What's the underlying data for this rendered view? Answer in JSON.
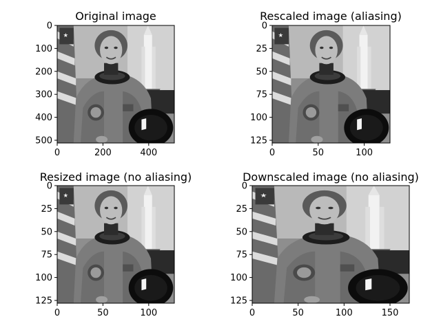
{
  "figure": {
    "background": "#ffffff"
  },
  "chart_data": [
    {
      "type": "image",
      "title": "Original image",
      "colormap": "gray",
      "xlim": [
        0,
        512
      ],
      "ylim": [
        512,
        0
      ],
      "xticks": [
        0,
        200,
        400
      ],
      "yticks": [
        0,
        100,
        200,
        300,
        400,
        500
      ]
    },
    {
      "type": "image",
      "title": "Rescaled image (aliasing)",
      "colormap": "gray",
      "xlim": [
        0,
        128
      ],
      "ylim": [
        128,
        0
      ],
      "xticks": [
        0,
        50,
        100
      ],
      "yticks": [
        0,
        25,
        50,
        75,
        100,
        125
      ]
    },
    {
      "type": "image",
      "title": "Resized image (no aliasing)",
      "colormap": "gray",
      "xlim": [
        0,
        128
      ],
      "ylim": [
        128,
        0
      ],
      "xticks": [
        0,
        50,
        100
      ],
      "yticks": [
        0,
        25,
        50,
        75,
        100,
        125
      ]
    },
    {
      "type": "image",
      "title": "Downscaled image (no aliasing)",
      "colormap": "gray",
      "xlim": [
        0,
        171
      ],
      "ylim": [
        128,
        0
      ],
      "xticks": [
        0,
        50,
        100,
        150
      ],
      "yticks": [
        0,
        25,
        50,
        75,
        100,
        125
      ]
    }
  ]
}
